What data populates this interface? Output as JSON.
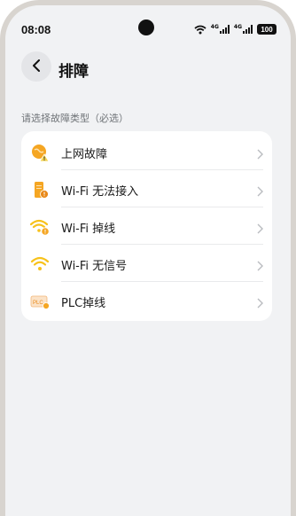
{
  "status_bar": {
    "time": "08:08",
    "net_label_1": "4G",
    "net_label_2": "4G",
    "battery": "100"
  },
  "header": {
    "title": "排障",
    "back_icon": "chevron-left-icon"
  },
  "section_hint": "请选择故障类型（必选）",
  "fault_types": [
    {
      "label": "上网故障",
      "icon": "internet-warning-icon"
    },
    {
      "label": "Wi-Fi 无法接入",
      "icon": "router-warning-icon"
    },
    {
      "label": "Wi-Fi 掉线",
      "icon": "wifi-warning-icon"
    },
    {
      "label": "Wi-Fi 无信号",
      "icon": "wifi-icon"
    },
    {
      "label": "PLC掉线",
      "icon": "plc-icon"
    }
  ],
  "colors": {
    "accent_orange": "#f5a623",
    "icon_yellow": "#f7c21b",
    "background": "#f1f2f4"
  }
}
